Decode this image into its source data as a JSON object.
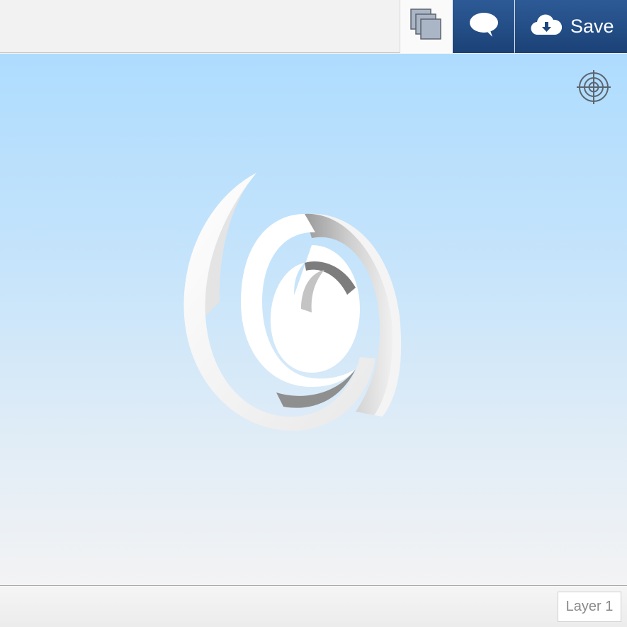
{
  "toolbar": {
    "layers_icon": "layers-icon",
    "comment_icon": "comment-icon",
    "save_icon": "cloud-download-icon",
    "save_label": "Save",
    "accent_color": "#1f477f"
  },
  "viewport": {
    "target_icon": "crosshair-target-icon",
    "background_top": "#aedcfe",
    "background_bottom": "#f3f3f4"
  },
  "footer": {
    "layer_label": "Layer 1"
  }
}
